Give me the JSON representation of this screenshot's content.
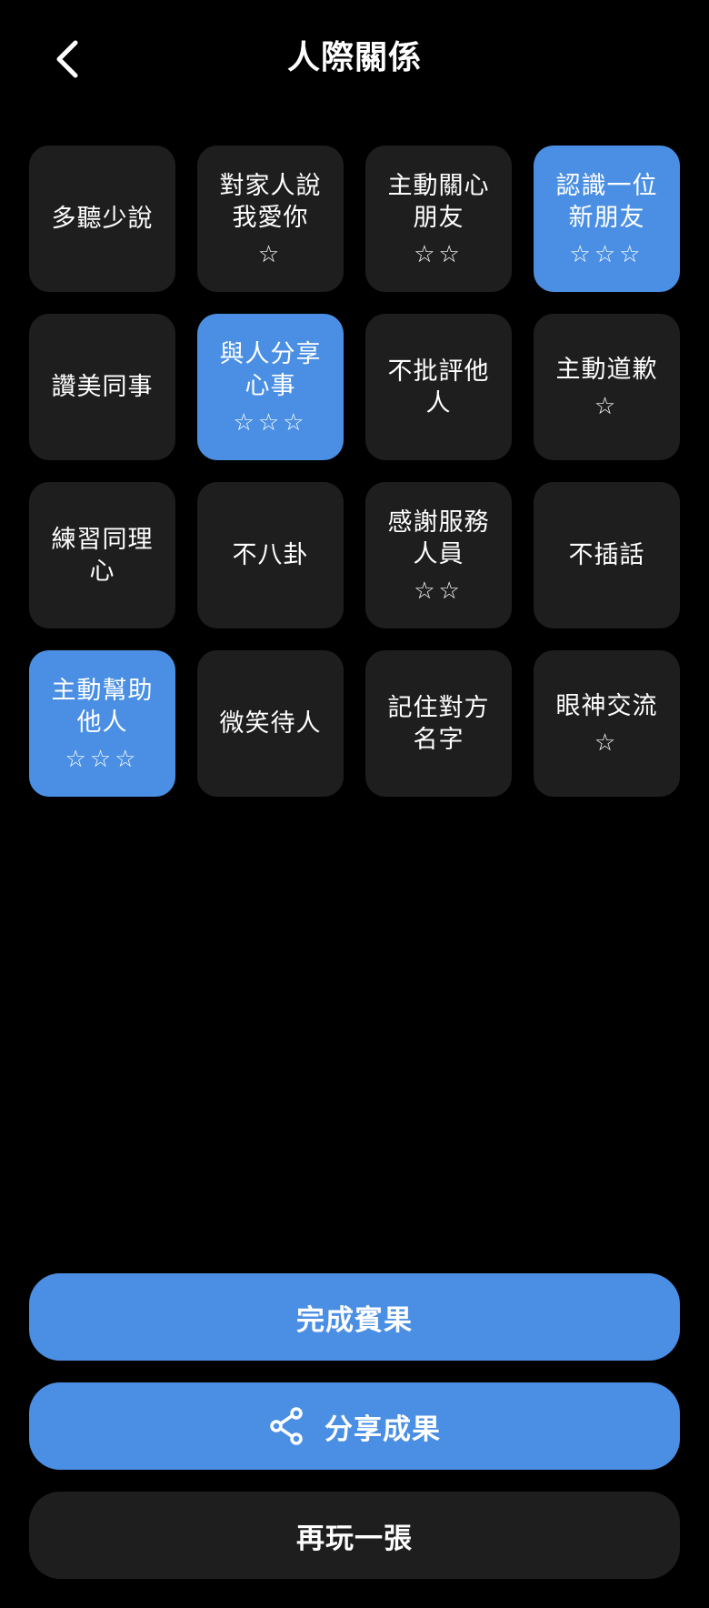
{
  "header": {
    "title": "人際關係",
    "back_icon": "chevron-left-icon"
  },
  "grid": {
    "cells": [
      {
        "label": "多聽少說",
        "stars": "",
        "active": false
      },
      {
        "label": "對家人說\n我愛你",
        "stars": "☆",
        "active": false
      },
      {
        "label": "主動關心\n朋友",
        "stars": "☆☆",
        "active": false
      },
      {
        "label": "認識一位\n新朋友",
        "stars": "☆☆☆",
        "active": true
      },
      {
        "label": "讚美同事",
        "stars": "",
        "active": false
      },
      {
        "label": "與人分享\n心事",
        "stars": "☆☆☆",
        "active": true
      },
      {
        "label": "不批評他\n人",
        "stars": "",
        "active": false
      },
      {
        "label": "主動道歉",
        "stars": "☆",
        "active": false
      },
      {
        "label": "練習同理\n心",
        "stars": "",
        "active": false
      },
      {
        "label": "不八卦",
        "stars": "",
        "active": false
      },
      {
        "label": "感謝服務\n人員",
        "stars": "☆☆",
        "active": false
      },
      {
        "label": "不插話",
        "stars": "",
        "active": false
      },
      {
        "label": "主動幫助\n他人",
        "stars": "☆☆☆",
        "active": true
      },
      {
        "label": "微笑待人",
        "stars": "",
        "active": false
      },
      {
        "label": "記住對方\n名字",
        "stars": "",
        "active": false
      },
      {
        "label": "眼神交流",
        "stars": "☆",
        "active": false
      }
    ]
  },
  "actions": {
    "complete_label": "完成賓果",
    "share_label": "分享成果",
    "share_icon": "share-icon",
    "again_label": "再玩一張"
  },
  "colors": {
    "background": "#000000",
    "cell": "#1e1e1e",
    "accent": "#4a8fe3",
    "text": "#ffffff"
  }
}
